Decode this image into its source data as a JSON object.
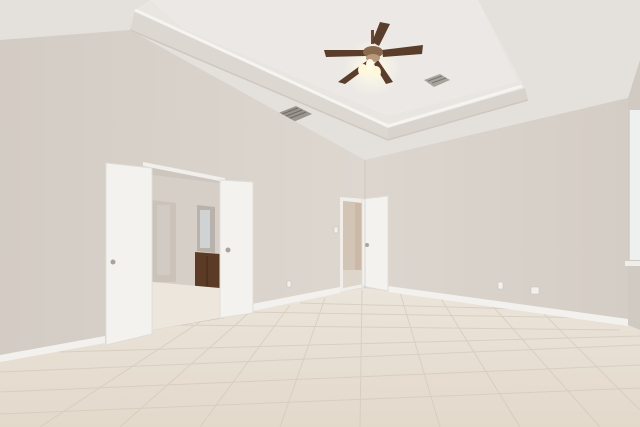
{
  "scene": {
    "subject": "empty-room-interior",
    "fixtures": [
      "ceiling-fan",
      "tray-ceiling",
      "air-vent",
      "air-vent",
      "double-doors",
      "single-door",
      "tile-floor",
      "baseboard",
      "wall-outlet",
      "light-switch",
      "cabinet",
      "window"
    ],
    "colors": {
      "wall": "#d9d3cc",
      "wall_shadow": "#cbc4bc",
      "ceiling": "#e6e2de",
      "tray": "#e0dbd6",
      "trim": "#f2f0ec",
      "floor": "#e8e0d4",
      "floor_grout": "#d6ccbd",
      "door": "#f3f2ee",
      "fan_blade": "#5a3d2b",
      "cabinet": "#5b3b26"
    }
  }
}
